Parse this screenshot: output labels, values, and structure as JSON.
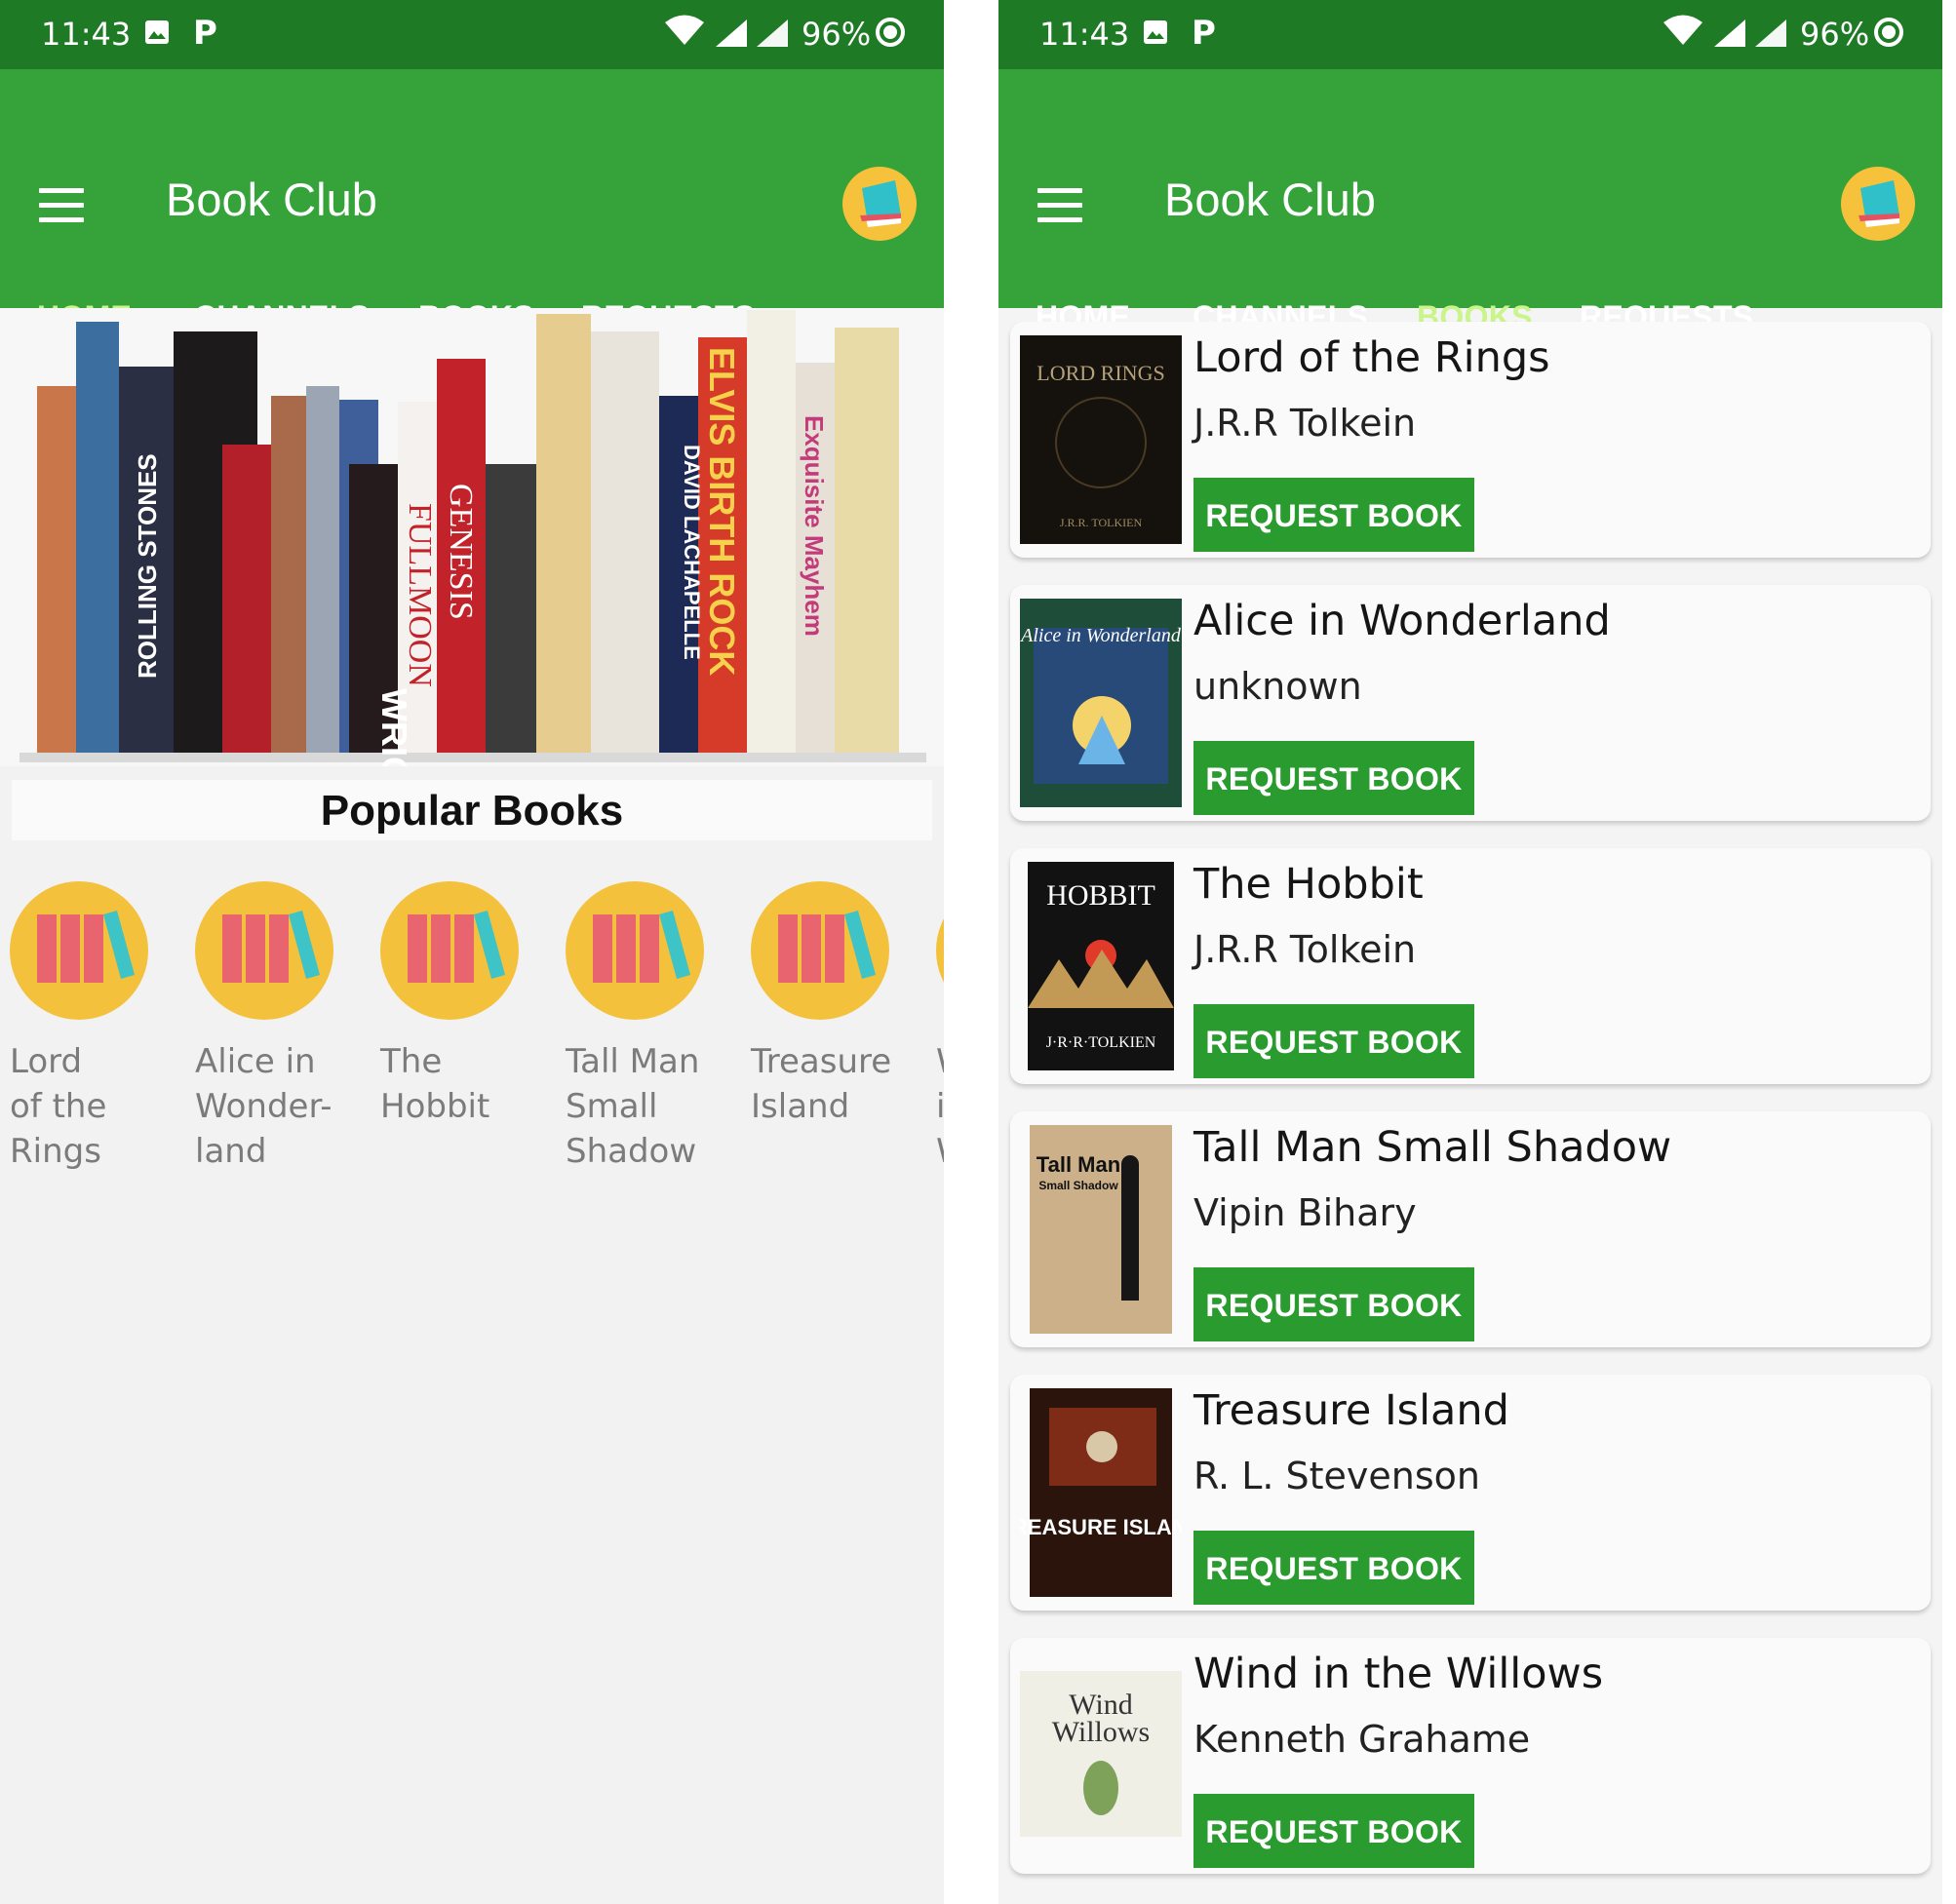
{
  "status_bar": {
    "time": "11:43",
    "battery": "96%"
  },
  "app": {
    "title": "Book Club"
  },
  "tabs": [
    "HOME",
    "CHANNELS",
    "BOOKS",
    "REQUESTS"
  ],
  "home": {
    "section_title": "Popular Books",
    "popular": [
      {
        "label": "Lord\nof the\nRings"
      },
      {
        "label": "Alice in\nWonder-\nland"
      },
      {
        "label": "The\nHobbit"
      },
      {
        "label": "Tall Man\nSmall\nShadow"
      },
      {
        "label": "Treasure\nIsland"
      },
      {
        "label": "W\ni\nW"
      }
    ],
    "hero_spines": [
      "ROLLING STONES",
      "WRIGHT",
      "FULLMOON",
      "GENESIS",
      "ELVIS BIRTH ROCK ROLL",
      "Exquisite Mayhem",
      "DAVID LACHAPELLE HEAVEN TO HELL"
    ]
  },
  "books": {
    "request_label": "REQUEST BOOK",
    "items": [
      {
        "title": "Lord of the Rings",
        "author": "J.R.R Tolkein",
        "cover_text": "LORD RINGS",
        "cover_sub": "J.R.R. TOLKIEN"
      },
      {
        "title": "Alice in Wonderland",
        "author": "unknown",
        "cover_text": "Alice in Wonderland",
        "cover_sub": ""
      },
      {
        "title": "The Hobbit",
        "author": "J.R.R Tolkein",
        "cover_text": "HOBBIT",
        "cover_sub": "J·R·R·TOLKIEN"
      },
      {
        "title": "Tall Man Small Shadow",
        "author": "Vipin Bihary",
        "cover_text": "Tall Man",
        "cover_sub": "Small Shadow"
      },
      {
        "title": "Treasure Island",
        "author": "R. L. Stevenson",
        "cover_text": "TREASURE ISLAND",
        "cover_sub": ""
      },
      {
        "title": "Wind in the Willows",
        "author": "Kenneth Grahame",
        "cover_text": "Wind",
        "cover_sub": "Willows"
      }
    ]
  },
  "colors": {
    "primary": "#35a33a",
    "dark": "#1f7a26",
    "accent": "#c9f58b",
    "button": "#2a9b2f"
  }
}
